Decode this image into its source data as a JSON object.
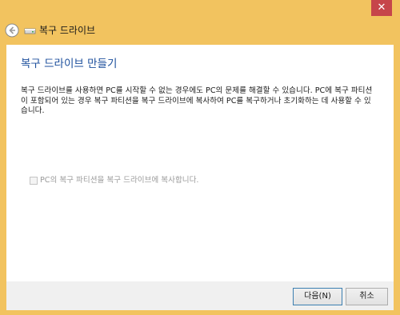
{
  "window": {
    "close_symbol": "✕",
    "accent_color": "#f2c35f",
    "close_color": "#c6454a"
  },
  "header": {
    "title": "복구 드라이브",
    "back_icon": "back-arrow-icon",
    "drive_icon": "drive-icon"
  },
  "main": {
    "page_title": "복구 드라이브 만들기",
    "description": "복구 드라이브를 사용하면 PC를 시작할 수 없는 경우에도 PC의 문제를 해결할 수 있습니다. PC에 복구 파티션이 포함되어 있는 경우 복구 파티션을 복구 드라이브에 복사하여 PC를 복구하거나 초기화하는 데 사용할 수 있습니다.",
    "checkbox_label": "PC의 복구 파티션을 복구 드라이브에 복사합니다.",
    "checkbox_checked": false,
    "checkbox_enabled": false
  },
  "footer": {
    "next_label": "다음(N)",
    "cancel_label": "취소"
  }
}
